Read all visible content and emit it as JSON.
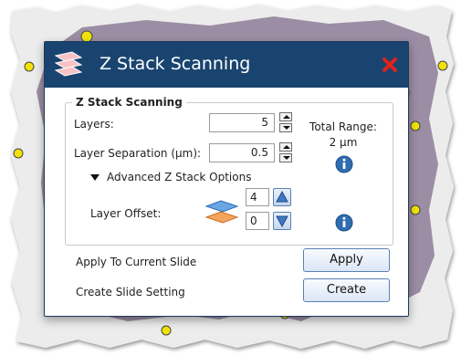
{
  "dialog": {
    "title": "Z Stack Scanning",
    "app_icon": "z-stack-layers-icon",
    "close_icon": "close-x-icon"
  },
  "group": {
    "title": "Z Stack Scanning",
    "layers_label": "Layers:",
    "layers_value": "5",
    "separation_label": "Layer Separation (µm):",
    "separation_value": "0.5",
    "total_range_label": "Total Range:",
    "total_range_value": "2 µm",
    "advanced_label": "Advanced Z Stack Options",
    "offset_label": "Layer Offset:",
    "offset_up_value": "4",
    "offset_down_value": "0"
  },
  "actions": {
    "apply_text": "Apply To Current Slide",
    "apply_button": "Apply",
    "create_text": "Create Slide Setting",
    "create_button": "Create"
  },
  "colors": {
    "titlebar": "#19446f",
    "close": "#e0231c",
    "button_border": "#5b80b2"
  }
}
